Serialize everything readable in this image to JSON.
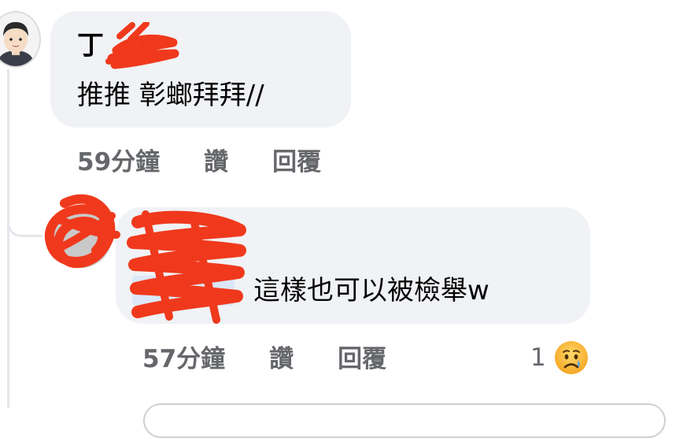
{
  "comment1": {
    "author": "丁",
    "text": "推推 彰螂拜拜//",
    "time": "59分鐘",
    "like_label": "讚",
    "reply_label": "回覆"
  },
  "comment2": {
    "text": "這樣也可以被檢舉w",
    "time": "57分鐘",
    "like_label": "讚",
    "reply_label": "回覆",
    "reaction_count": "1",
    "reaction_icon": "sad-face-icon"
  },
  "colors": {
    "bubble": "#f0f2f5",
    "meta_text": "#65676b",
    "redaction": "#f0391c"
  }
}
